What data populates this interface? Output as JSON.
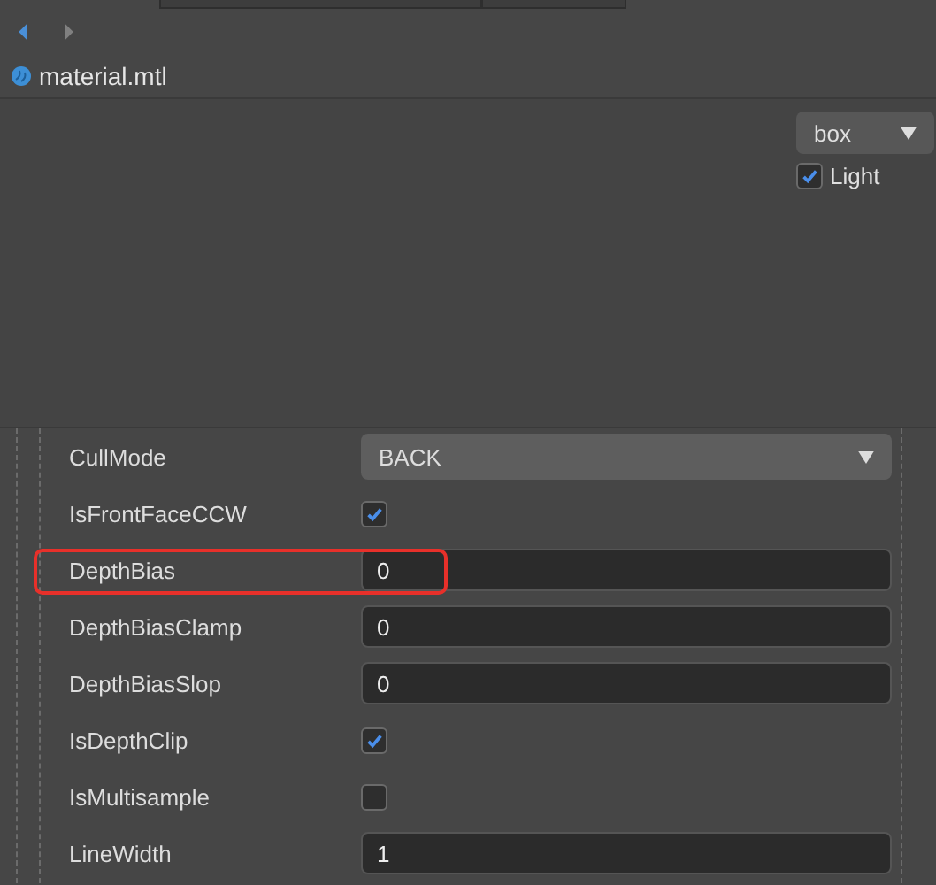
{
  "nav": {
    "back_enabled": true,
    "forward_enabled": false
  },
  "file": {
    "name": "material.mtl"
  },
  "preview": {
    "dropdown": {
      "value": "box"
    },
    "light": {
      "label": "Light",
      "checked": true
    }
  },
  "properties": [
    {
      "kind": "select",
      "label": "CullMode",
      "value": "BACK",
      "highlighted": false
    },
    {
      "kind": "checkbox",
      "label": "IsFrontFaceCCW",
      "checked": true,
      "highlighted": false
    },
    {
      "kind": "input",
      "label": "DepthBias",
      "value": "0",
      "highlighted": true
    },
    {
      "kind": "input",
      "label": "DepthBiasClamp",
      "value": "0",
      "highlighted": false
    },
    {
      "kind": "input",
      "label": "DepthBiasSlop",
      "value": "0",
      "highlighted": false
    },
    {
      "kind": "checkbox",
      "label": "IsDepthClip",
      "checked": true,
      "highlighted": false
    },
    {
      "kind": "checkbox",
      "label": "IsMultisample",
      "checked": false,
      "highlighted": false
    },
    {
      "kind": "input",
      "label": "LineWidth",
      "value": "1",
      "highlighted": false
    }
  ]
}
